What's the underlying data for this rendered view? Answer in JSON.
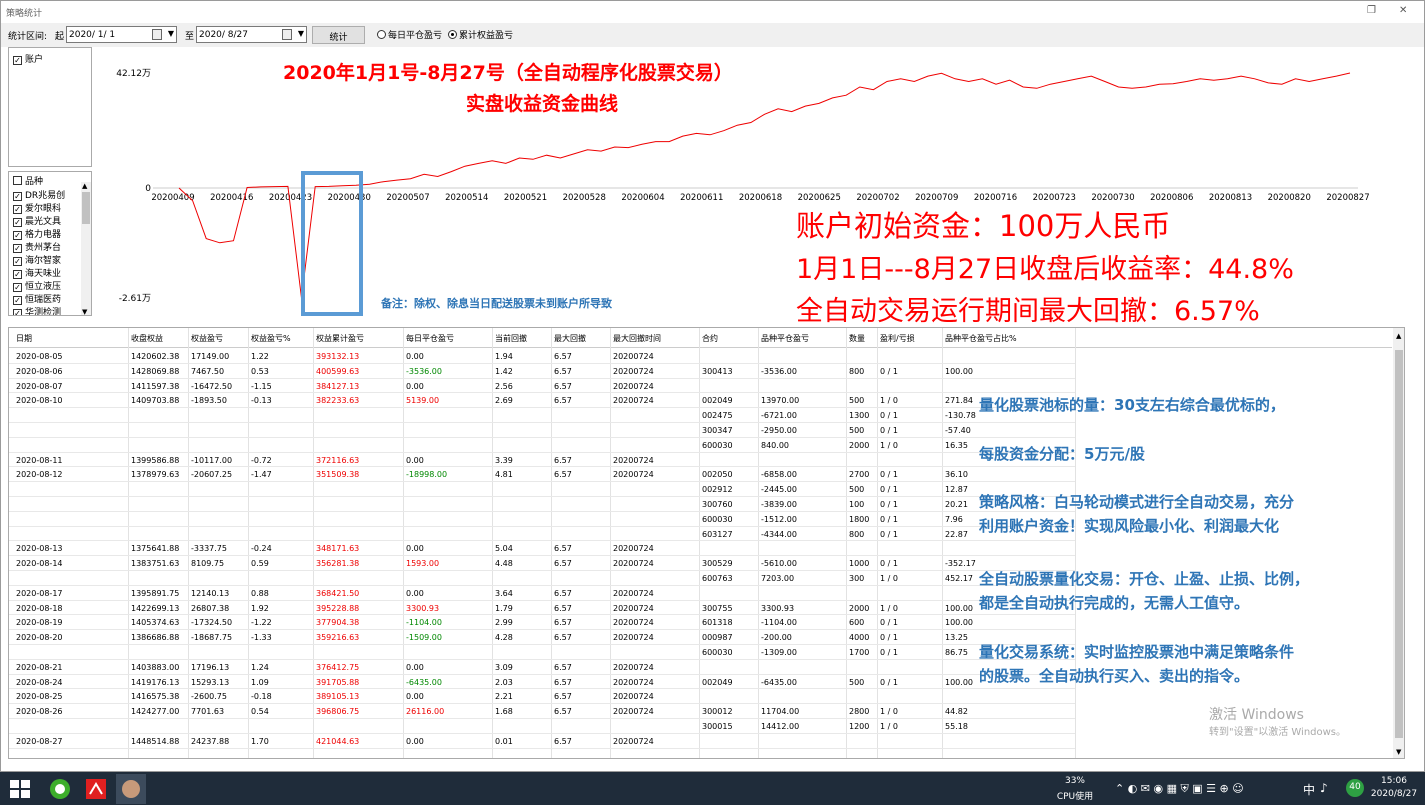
{
  "window": {
    "title": "策略统计"
  },
  "toolbar": {
    "range_label": "统计区间:",
    "start_label": "起",
    "start_date": "2020/ 1/ 1",
    "to_label": "至",
    "end_date": "2020/ 8/27",
    "stat_button": "统计",
    "radio_daily": "每日平仓盈亏",
    "radio_cum": "累计权益盈亏"
  },
  "account_panel": {
    "item": "账户"
  },
  "product_panel": {
    "header": "品种",
    "items": [
      "DR兆易创",
      "爱尔眼科",
      "晨光文具",
      "格力电器",
      "贵州茅台",
      "海尔智家",
      "海天味业",
      "恒立液压",
      "恒瑞医药",
      "华测检测"
    ]
  },
  "annotations": {
    "title1": "2020年1月1号-8月27号（全自动程序化股票交易）",
    "title2": "实盘收益资金曲线",
    "note": "备注：除权、除息当日配送股票未到账户所导致",
    "big1": "账户初始资金：100万人民币",
    "big2": "1月1日---8月27日收盘后收益率：44.8%",
    "big3": "全自动交易运行期间最大回撤：6.57%",
    "blue": [
      "量化股票池标的量：30支左右综合最优标的，",
      "每股资金分配：5万元/股",
      "策略风格：白马轮动模式进行全自动交易，充分",
      "利用账户资金！实现风险最小化、利润最大化",
      "全自动股票量化交易：开仓、止盈、止损、比例，",
      "都是全自动执行完成的，无需人工值守。",
      "量化交易系统：实时监控股票池中满足策略条件",
      "的股票。全自动执行买入、卖出的指令。"
    ],
    "watermark1": "激活 Windows",
    "watermark2": "转到\"设置\"以激活 Windows。"
  },
  "chart_data": {
    "type": "line",
    "y_tick_labels": [
      "42.12万",
      "0",
      "-2.61万"
    ],
    "ylim": [
      -2.61,
      42.12
    ],
    "x_tick_labels": [
      "20200409",
      "20200416",
      "20200423",
      "20200430",
      "20200507",
      "20200514",
      "20200521",
      "20200528",
      "20200604",
      "20200611",
      "20200618",
      "20200625",
      "20200702",
      "20200709",
      "20200716",
      "20200723",
      "20200730",
      "20200806",
      "20200813",
      "20200820",
      "20200827"
    ],
    "values": [
      0,
      -0.3,
      -1.2,
      -1.3,
      -1.25,
      0.2,
      0.4,
      0.5,
      0.6,
      -2.61,
      0.5,
      0.6,
      0.8,
      1.0,
      1.4,
      2.3,
      2.9,
      3.4,
      5,
      4.2,
      6,
      8,
      9,
      10,
      9,
      11,
      10.5,
      12,
      11,
      12.5,
      14,
      13.5,
      15,
      14.8,
      16,
      17,
      17,
      19,
      20,
      19.5,
      21,
      23,
      24,
      27,
      29,
      28,
      30,
      31,
      33,
      34,
      37,
      36,
      39,
      40,
      39,
      41,
      42,
      40,
      39,
      40,
      38,
      39.5,
      37,
      36.5,
      38,
      39,
      40,
      41,
      39,
      37,
      36.5,
      37,
      38,
      38.2,
      39,
      40,
      39.5,
      40,
      41,
      40,
      38.5,
      38,
      40,
      39,
      40,
      41,
      42.12
    ]
  },
  "grid": {
    "headers": [
      "日期",
      "收盘权益",
      "权益盈亏",
      "权益盈亏%",
      "权益累计盈亏",
      "每日平仓盈亏",
      "当前回撤",
      "最大回撤",
      "最大回撤时间",
      "合约",
      "品种平仓盈亏",
      "数量",
      "盈利/亏损",
      "品种平仓盈亏占比%"
    ],
    "rows": [
      [
        "2020-08-05",
        "1420602.38",
        "17149.00",
        "1.22",
        "393132.13",
        "0.00",
        "1.94",
        "6.57",
        "20200724",
        "",
        "",
        "",
        "",
        ""
      ],
      [
        "2020-08-06",
        "1428069.88",
        "7467.50",
        "0.53",
        "400599.63",
        "-3536.00",
        "1.42",
        "6.57",
        "20200724",
        "300413",
        "-3536.00",
        "800",
        "0 / 1",
        "100.00"
      ],
      [
        "2020-08-07",
        "1411597.38",
        "-16472.50",
        "-1.15",
        "384127.13",
        "0.00",
        "2.56",
        "6.57",
        "20200724",
        "",
        "",
        "",
        "",
        ""
      ],
      [
        "2020-08-10",
        "1409703.88",
        "-1893.50",
        "-0.13",
        "382233.63",
        "5139.00",
        "2.69",
        "6.57",
        "20200724",
        "002049",
        "13970.00",
        "500",
        "1 / 0",
        "271.84"
      ],
      [
        "",
        "",
        "",
        "",
        "",
        "",
        "",
        "",
        "",
        "002475",
        "-6721.00",
        "1300",
        "0 / 1",
        "-130.78"
      ],
      [
        "",
        "",
        "",
        "",
        "",
        "",
        "",
        "",
        "",
        "300347",
        "-2950.00",
        "500",
        "0 / 1",
        "-57.40"
      ],
      [
        "",
        "",
        "",
        "",
        "",
        "",
        "",
        "",
        "",
        "600030",
        "840.00",
        "2000",
        "1 / 0",
        "16.35"
      ],
      [
        "2020-08-11",
        "1399586.88",
        "-10117.00",
        "-0.72",
        "372116.63",
        "0.00",
        "3.39",
        "6.57",
        "20200724",
        "",
        "",
        "",
        "",
        ""
      ],
      [
        "2020-08-12",
        "1378979.63",
        "-20607.25",
        "-1.47",
        "351509.38",
        "-18998.00",
        "4.81",
        "6.57",
        "20200724",
        "002050",
        "-6858.00",
        "2700",
        "0 / 1",
        "36.10"
      ],
      [
        "",
        "",
        "",
        "",
        "",
        "",
        "",
        "",
        "",
        "002912",
        "-2445.00",
        "500",
        "0 / 1",
        "12.87"
      ],
      [
        "",
        "",
        "",
        "",
        "",
        "",
        "",
        "",
        "",
        "300760",
        "-3839.00",
        "100",
        "0 / 1",
        "20.21"
      ],
      [
        "",
        "",
        "",
        "",
        "",
        "",
        "",
        "",
        "",
        "600030",
        "-1512.00",
        "1800",
        "0 / 1",
        "7.96"
      ],
      [
        "",
        "",
        "",
        "",
        "",
        "",
        "",
        "",
        "",
        "603127",
        "-4344.00",
        "800",
        "0 / 1",
        "22.87"
      ],
      [
        "2020-08-13",
        "1375641.88",
        "-3337.75",
        "-0.24",
        "348171.63",
        "0.00",
        "5.04",
        "6.57",
        "20200724",
        "",
        "",
        "",
        "",
        ""
      ],
      [
        "2020-08-14",
        "1383751.63",
        "8109.75",
        "0.59",
        "356281.38",
        "1593.00",
        "4.48",
        "6.57",
        "20200724",
        "300529",
        "-5610.00",
        "1000",
        "0 / 1",
        "-352.17"
      ],
      [
        "",
        "",
        "",
        "",
        "",
        "",
        "",
        "",
        "",
        "600763",
        "7203.00",
        "300",
        "1 / 0",
        "452.17"
      ],
      [
        "2020-08-17",
        "1395891.75",
        "12140.13",
        "0.88",
        "368421.50",
        "0.00",
        "3.64",
        "6.57",
        "20200724",
        "",
        "",
        "",
        "",
        ""
      ],
      [
        "2020-08-18",
        "1422699.13",
        "26807.38",
        "1.92",
        "395228.88",
        "3300.93",
        "1.79",
        "6.57",
        "20200724",
        "300755",
        "3300.93",
        "2000",
        "1 / 0",
        "100.00"
      ],
      [
        "2020-08-19",
        "1405374.63",
        "-17324.50",
        "-1.22",
        "377904.38",
        "-1104.00",
        "2.99",
        "6.57",
        "20200724",
        "601318",
        "-1104.00",
        "600",
        "0 / 1",
        "100.00"
      ],
      [
        "2020-08-20",
        "1386686.88",
        "-18687.75",
        "-1.33",
        "359216.63",
        "-1509.00",
        "4.28",
        "6.57",
        "20200724",
        "000987",
        "-200.00",
        "4000",
        "0 / 1",
        "13.25"
      ],
      [
        "",
        "",
        "",
        "",
        "",
        "",
        "",
        "",
        "",
        "600030",
        "-1309.00",
        "1700",
        "0 / 1",
        "86.75"
      ],
      [
        "2020-08-21",
        "1403883.00",
        "17196.13",
        "1.24",
        "376412.75",
        "0.00",
        "3.09",
        "6.57",
        "20200724",
        "",
        "",
        "",
        "",
        ""
      ],
      [
        "2020-08-24",
        "1419176.13",
        "15293.13",
        "1.09",
        "391705.88",
        "-6435.00",
        "2.03",
        "6.57",
        "20200724",
        "002049",
        "-6435.00",
        "500",
        "0 / 1",
        "100.00"
      ],
      [
        "2020-08-25",
        "1416575.38",
        "-2600.75",
        "-0.18",
        "389105.13",
        "0.00",
        "2.21",
        "6.57",
        "20200724",
        "",
        "",
        "",
        "",
        ""
      ],
      [
        "2020-08-26",
        "1424277.00",
        "7701.63",
        "0.54",
        "396806.75",
        "26116.00",
        "1.68",
        "6.57",
        "20200724",
        "300012",
        "11704.00",
        "2800",
        "1 / 0",
        "44.82"
      ],
      [
        "",
        "",
        "",
        "",
        "",
        "",
        "",
        "",
        "",
        "300015",
        "14412.00",
        "1200",
        "1 / 0",
        "55.18"
      ],
      [
        "2020-08-27",
        "1448514.88",
        "24237.88",
        "1.70",
        "421044.63",
        "0.00",
        "0.01",
        "6.57",
        "20200724",
        "",
        "",
        "",
        "",
        ""
      ]
    ]
  },
  "taskbar": {
    "cpu_pct": "33%",
    "cpu_label": "CPU使用",
    "ime": "中",
    "time": "15:06",
    "date": "2020/8/27",
    "badge": "40"
  }
}
